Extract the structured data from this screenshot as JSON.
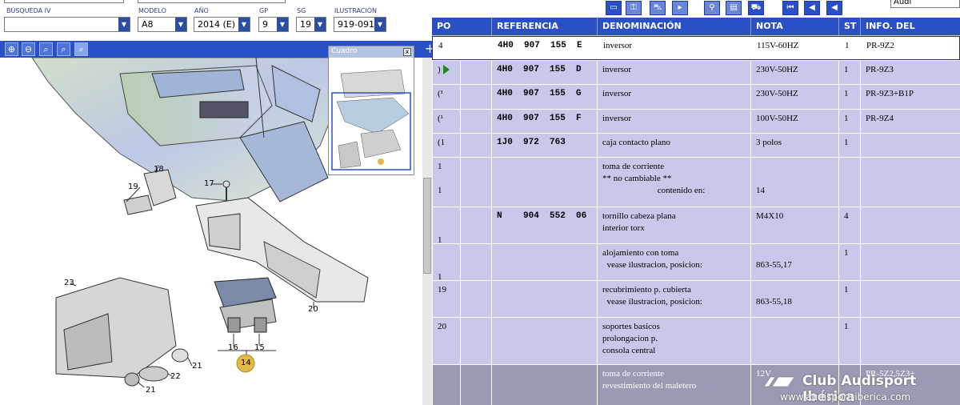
{
  "filters": {
    "busqueda_label": "BÚSQUEDA IV",
    "busqueda_value": "",
    "modelo_label": "MODELO",
    "modelo_value": "A8",
    "anio_label": "AÑO",
    "anio_value": "2014 (E)",
    "gp_label": "GP",
    "gp_value": "9",
    "sg_label": "SG",
    "sg_value": "19",
    "ilustracion_label": "ILUSTRACIÓN",
    "ilustracion_value": "919-091"
  },
  "cuadro": {
    "title": "Cuadro",
    "close": "x"
  },
  "brand_select": "Audi",
  "callouts": [
    "18",
    "19",
    "17",
    "23",
    "20",
    "16",
    "15",
    "14",
    "22",
    "21",
    "21"
  ],
  "table": {
    "headers": [
      "PO",
      "REFERENCIA",
      "DENOMINACIÓN",
      "NOTA",
      "ST",
      "INFO. DEL MODELO"
    ],
    "rows": [
      {
        "pos": "4",
        "ref": "4H0  907  155  E",
        "den": "inversor",
        "nota": "115V-60HZ",
        "st": "1",
        "info": "PR-9Z2"
      },
      {
        "pos": ")",
        "ref": "4H0  907  155  D",
        "den": "inversor",
        "nota": "230V-50HZ",
        "st": "1",
        "info": "PR-9Z3"
      },
      {
        "pos": "(¹",
        "ref": "4H0  907  155  G",
        "den": "inversor",
        "nota": "230V-50HZ",
        "st": "1",
        "info": "PR-9Z3+B1P"
      },
      {
        "pos": "(¹",
        "ref": "4H0  907  155  F",
        "den": "inversor",
        "nota": "100V-50HZ",
        "st": "1",
        "info": "PR-9Z4"
      },
      {
        "pos": "(1",
        "ref": "1J0  972  763",
        "den": "caja contacto plano",
        "nota": "3 polos",
        "st": "1",
        "info": ""
      },
      {
        "pos": "1\n\n1",
        "ref": "",
        "den": "toma de corriente\n** no cambiable **\n                         contenido en:",
        "nota": "\n\n14",
        "st": "",
        "info": ""
      },
      {
        "pos": "\n\n1",
        "ref": "N    904  552  06",
        "den": "tornillo cabeza plana\ninterior torx",
        "nota": "M4X10",
        "st": "4",
        "info": ""
      },
      {
        "pos": "\n\n1",
        "ref": "",
        "den": "alojamiento con toma\n  vease ilustracion, posicion:",
        "nota": "\n863-55,17",
        "st": "1",
        "info": ""
      },
      {
        "pos": "19",
        "ref": "",
        "den": "recubrimiento p. cubierta\n  vease ilustracion, posicion:",
        "nota": "\n863-55,18",
        "st": "1",
        "info": ""
      },
      {
        "pos": "20",
        "ref": "",
        "den": "soportes basicos\nprolongacion p.\nconsola central",
        "nota": "",
        "st": "1",
        "info": ""
      },
      {
        "pos": "",
        "ref": "",
        "den": "toma de corriente\nrevestimiento del maletero",
        "nota": "12V",
        "st": "",
        "info": "PR-5Z2,5Z3+"
      }
    ]
  },
  "watermark": {
    "logo": "Club Audisport Ibérica",
    "url": "www.audisport-iberica.com"
  }
}
